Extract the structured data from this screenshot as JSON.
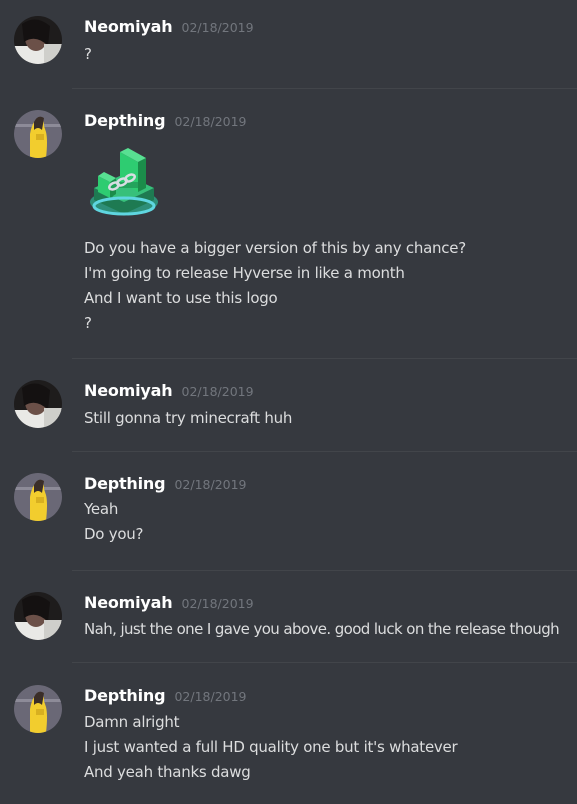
{
  "messages": [
    {
      "username": "Neomiyah",
      "timestamp": "02/18/2019",
      "avatar": "avatar-neomiyah",
      "lines": [
        "?"
      ]
    },
    {
      "username": "Depthing",
      "timestamp": "02/18/2019",
      "avatar": "avatar-depthing",
      "attachment_icon": "hyverse-logo-icon",
      "lines": [
        "Do you have a bigger version of this by any chance?",
        "I'm going to release Hyverse in like a month",
        "And I want to use this logo",
        "?"
      ]
    },
    {
      "username": "Neomiyah",
      "timestamp": "02/18/2019",
      "avatar": "avatar-neomiyah",
      "lines": [
        "Still gonna try minecraft huh"
      ]
    },
    {
      "username": "Depthing",
      "timestamp": "02/18/2019",
      "avatar": "avatar-depthing",
      "lines": [
        "Yeah",
        "Do you?"
      ]
    },
    {
      "username": "Neomiyah",
      "timestamp": "02/18/2019",
      "avatar": "avatar-neomiyah",
      "lines": [
        "Nah, just the one I gave you above. good luck on the release though"
      ]
    },
    {
      "username": "Depthing",
      "timestamp": "02/18/2019",
      "avatar": "avatar-depthing",
      "lines": [
        "Damn alright",
        "I just wanted a full HD quality one but it's whatever",
        "And yeah thanks dawg"
      ]
    }
  ],
  "colors": {
    "background": "#36393f",
    "username": "#ffffff",
    "timestamp": "#72767d",
    "text": "#dcddde",
    "divider": "#42454a"
  }
}
